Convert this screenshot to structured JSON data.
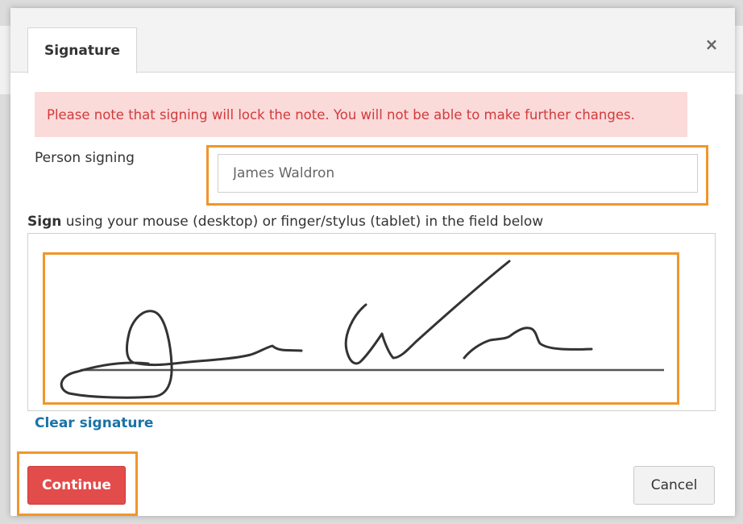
{
  "dialog": {
    "tab_title": "Signature",
    "close_glyph": "×"
  },
  "notice": {
    "text": "Please note that signing will lock the note. You will not be able to make further changes."
  },
  "person": {
    "label": "Person signing",
    "value": "James Waldron"
  },
  "sign": {
    "instruction_bold": "Sign",
    "instruction_rest": " using your mouse (desktop) or finger/stylus (tablet) in the field below",
    "clear_label": "Clear signature"
  },
  "actions": {
    "continue_label": "Continue",
    "cancel_label": "Cancel"
  },
  "colors": {
    "highlight": "#f0962b",
    "continue_bg": "#e24c4b",
    "notice_bg": "#fbdada",
    "notice_text": "#d13b3b",
    "link": "#1a73a6"
  }
}
